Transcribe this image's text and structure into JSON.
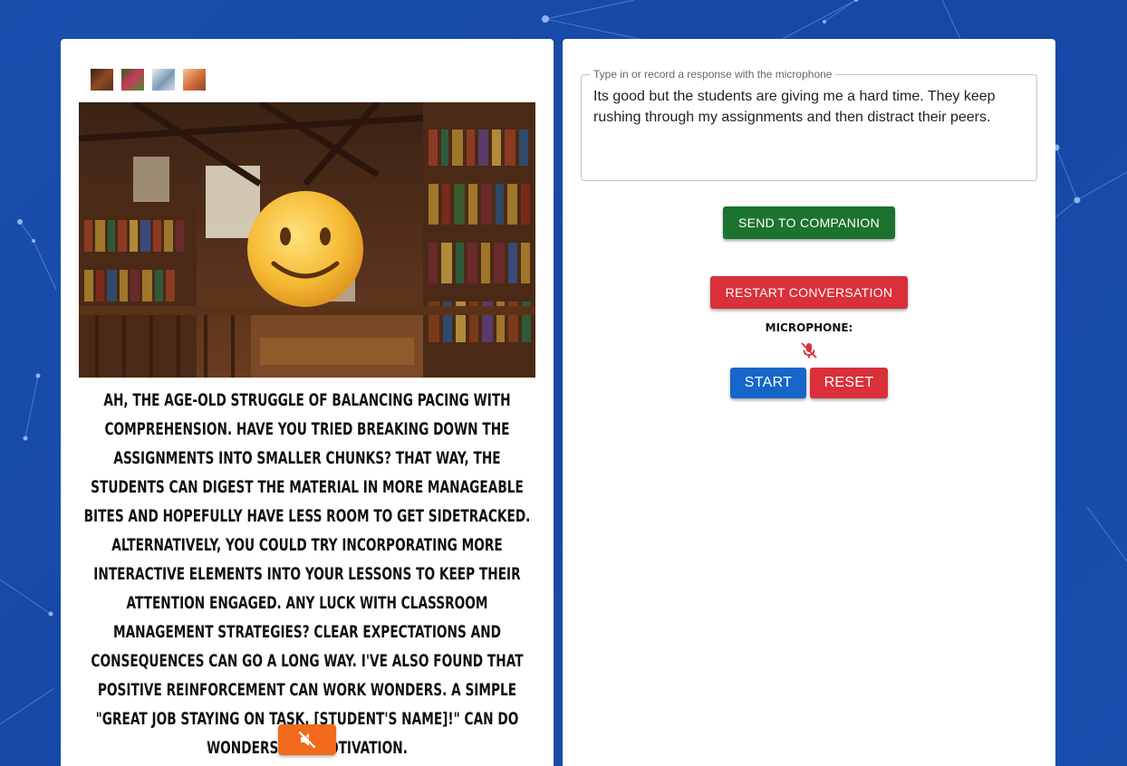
{
  "companion": {
    "thumbnails": [
      {
        "name": "library-thumb",
        "color": "#6b3a22"
      },
      {
        "name": "garden-thumb",
        "color": "#3e7a2a"
      },
      {
        "name": "snow-thumb",
        "color": "#b9cde0"
      },
      {
        "name": "sunset-thumb",
        "color": "#d9824a"
      }
    ],
    "scene_icon": "smiling-face-emoji",
    "reply_text": "Ah, the age-old struggle of balancing pacing with comprehension. Have you tried breaking down the assignments into smaller chunks? That way, the students can digest the material in more manageable bites and hopefully have less room to get sidetracked. Alternatively, you could try incorporating more interactive elements into your lessons to keep their attention engaged. Any luck with classroom management strategies? Clear expectations and consequences can go a long way. I've also found that positive reinforcement can work wonders. A simple \"Great job staying on task, [student's name]!\" can do wonders for motivation.",
    "mute_icon": "speaker-muted-icon",
    "mute_color": "#f26a1b"
  },
  "response": {
    "legend": "Type in or record a response with the microphone",
    "text": "Its good but the students are giving me a hard time. They keep rushing through my assignments and then distract their peers."
  },
  "buttons": {
    "send": "SEND TO COMPANION",
    "restart": "RESTART CONVERSATION",
    "start": "START",
    "reset": "RESET"
  },
  "microphone": {
    "label": "Microphone:",
    "icon": "microphone-off-icon",
    "icon_color": "#d9303a"
  },
  "colors": {
    "background": "#1a4fae",
    "send": "#1c7330",
    "restart": "#d9303a",
    "start": "#1566c8",
    "reset": "#d9303a"
  }
}
